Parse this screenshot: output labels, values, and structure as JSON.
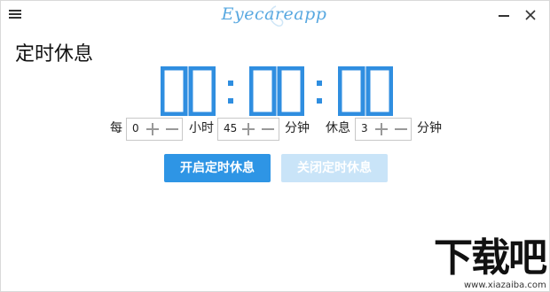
{
  "app": {
    "brand": "Eyecareapp"
  },
  "window": {
    "minimize_icon": "minimize-icon",
    "close_icon": "close-icon",
    "menu_icon": "hamburger-menu-icon"
  },
  "page": {
    "title": "定时休息"
  },
  "timer": {
    "hours": "00",
    "minutes": "00",
    "seconds": "00",
    "color": "#2f8ee0"
  },
  "settings": {
    "every_label": "每",
    "interval_hours": "0",
    "hours_label": "小时",
    "interval_minutes": "45",
    "minutes_label": "分钟",
    "rest_label": "休息",
    "rest_minutes": "3",
    "rest_unit_label": "分钟"
  },
  "buttons": {
    "start": "开启定时休息",
    "stop": "关闭定时休息"
  },
  "colors": {
    "accent": "#2e95e5",
    "disabled": "#c9e4f8"
  },
  "watermark": {
    "logo_text": "下载吧",
    "url": "www.xiazaiba.com"
  }
}
